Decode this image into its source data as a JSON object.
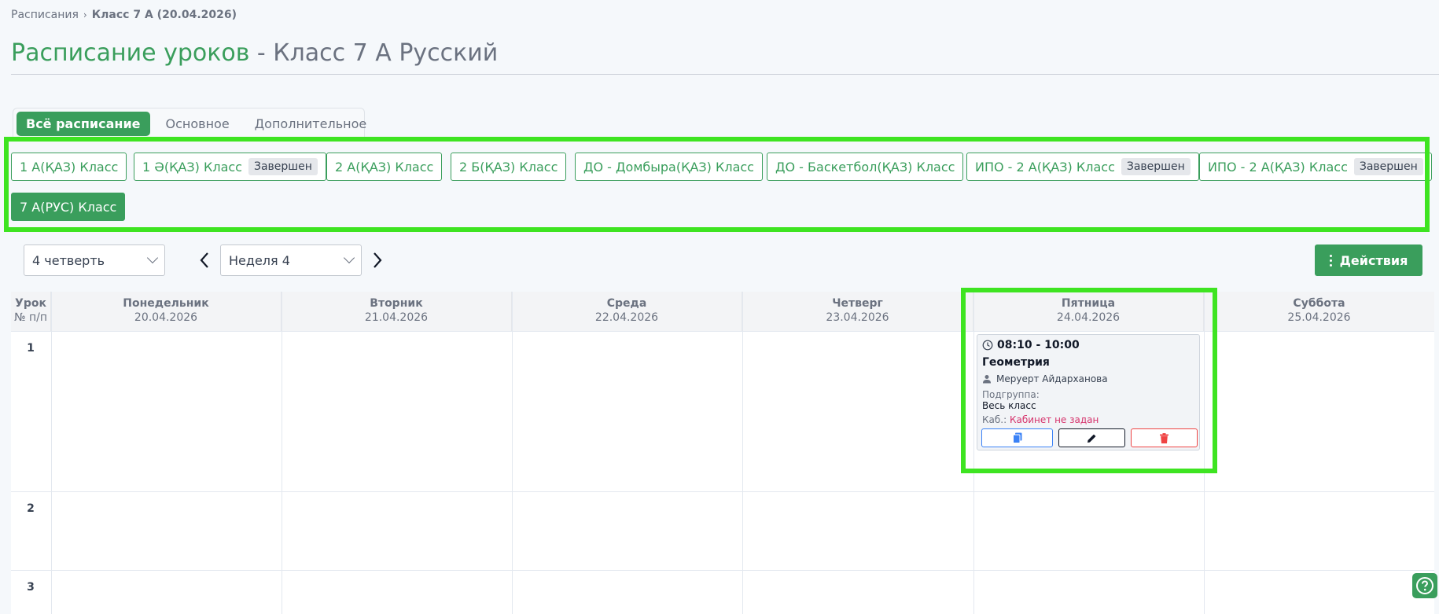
{
  "breadcrumb": {
    "root": "Расписания",
    "current": "Класс 7 А (20.04.2026)"
  },
  "title": {
    "main": "Расписание уроков",
    "suffix": " - Класс 7 А Русский"
  },
  "tabs": [
    {
      "label": "Всё расписание",
      "active": true
    },
    {
      "label": "Основное",
      "active": false
    },
    {
      "label": "Дополнительное",
      "active": false
    }
  ],
  "classes": [
    {
      "label": "1 А(ҚАЗ) Класс",
      "badge": ""
    },
    {
      "label": "1 Ә(ҚАЗ) Класс",
      "badge": "Завершен"
    },
    {
      "label": "2 А(ҚАЗ) Класс",
      "badge": ""
    },
    {
      "label": "2 Б(ҚАЗ) Класс",
      "badge": ""
    },
    {
      "label": "ДО - Домбыра(ҚАЗ) Класс",
      "badge": ""
    },
    {
      "label": "ДО - Баскетбол(ҚАЗ) Класс",
      "badge": ""
    },
    {
      "label": "ИПО - 2 А(ҚАЗ) Класс",
      "badge": "Завершен"
    },
    {
      "label": "ИПО - 2 А(ҚАЗ) Класс",
      "badge": "Завершен"
    },
    {
      "label": "7 А(РУС) Класс",
      "badge": "",
      "active": true
    }
  ],
  "controls": {
    "quarter": "4 четверть",
    "week": "Неделя 4",
    "actions_label": "Действия"
  },
  "grid": {
    "lesson_header": "Урок",
    "number_header": "№ п/п",
    "days": [
      {
        "day": "Понедельник",
        "date": "20.04.2026"
      },
      {
        "day": "Вторник",
        "date": "21.04.2026"
      },
      {
        "day": "Среда",
        "date": "22.04.2026"
      },
      {
        "day": "Четверг",
        "date": "23.04.2026"
      },
      {
        "day": "Пятница",
        "date": "24.04.2026"
      },
      {
        "day": "Суббота",
        "date": "25.04.2026"
      }
    ],
    "rows": [
      "1",
      "2",
      "3"
    ]
  },
  "lesson": {
    "time": "08:10 - 10:00",
    "subject": "Геометрия",
    "teacher": "Меруерт Айдарханова",
    "subgroup_label": "Подгруппа:",
    "subgroup_value": "Весь класс",
    "room_label": "Каб.:",
    "room_value": "Кабинет не задан"
  },
  "colors": {
    "brand_green": "#3a9e5c",
    "highlight": "#3ee421",
    "danger": "#ef4444"
  }
}
